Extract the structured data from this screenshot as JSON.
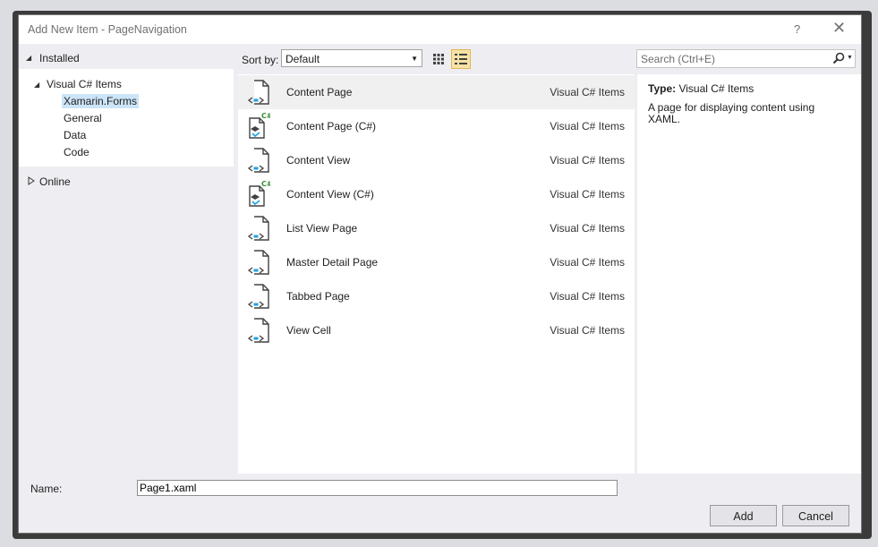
{
  "window": {
    "title": "Add New Item - PageNavigation",
    "help_label": "?",
    "close_label": "✕"
  },
  "left_pane": {
    "installed_label": "Installed",
    "tree_root_label": "Visual C# Items",
    "tree_children": [
      "Xamarin.Forms",
      "General",
      "Data",
      "Code"
    ],
    "online_label": "Online"
  },
  "toolbar": {
    "sort_by_label": "Sort by:",
    "sort_value": "Default",
    "search_placeholder": "Search (Ctrl+E)"
  },
  "templates": [
    {
      "name": "Content Page",
      "category": "Visual C# Items",
      "icon": "xaml-page-icon"
    },
    {
      "name": "Content Page (C#)",
      "category": "Visual C# Items",
      "icon": "csharp-page-icon"
    },
    {
      "name": "Content View",
      "category": "Visual C# Items",
      "icon": "xaml-page-icon"
    },
    {
      "name": "Content View (C#)",
      "category": "Visual C# Items",
      "icon": "csharp-page-icon"
    },
    {
      "name": "List View Page",
      "category": "Visual C# Items",
      "icon": "xaml-page-icon"
    },
    {
      "name": "Master Detail Page",
      "category": "Visual C# Items",
      "icon": "xaml-page-icon"
    },
    {
      "name": "Tabbed Page",
      "category": "Visual C# Items",
      "icon": "xaml-page-icon"
    },
    {
      "name": "View Cell",
      "category": "Visual C# Items",
      "icon": "xaml-page-icon"
    }
  ],
  "details": {
    "type_label": "Type:",
    "type_value": "Visual C# Items",
    "description": "A page for displaying content using XAML."
  },
  "footer": {
    "name_label": "Name:",
    "name_value": "Page1.xaml",
    "add_label": "Add",
    "cancel_label": "Cancel"
  },
  "colors": {
    "selection": "#cce4f7",
    "active_view_button": "#f7e3a6",
    "csharp_badge": "#388a34",
    "icon_accent": "#1ba1e2"
  }
}
